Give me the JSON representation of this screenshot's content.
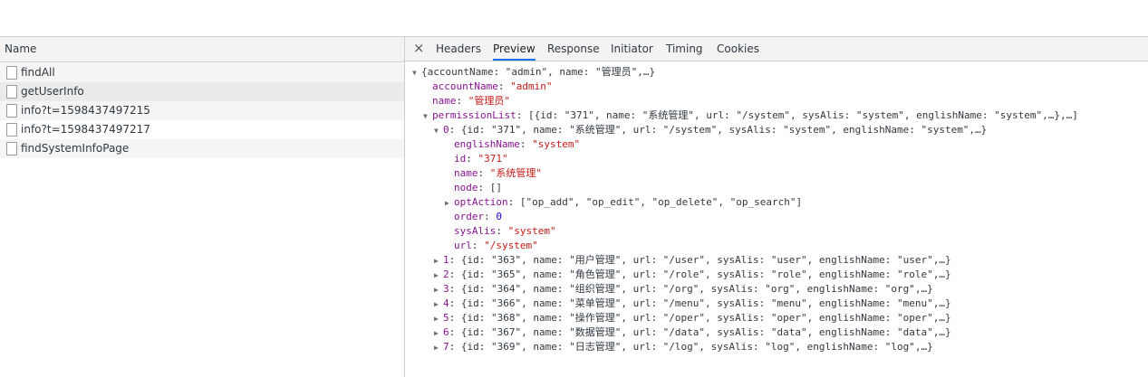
{
  "network": {
    "column_header": "Name",
    "requests": [
      {
        "name": "findAll"
      },
      {
        "name": "getUserInfo"
      },
      {
        "name": "info?t=1598437497215"
      },
      {
        "name": "info?t=1598437497217"
      },
      {
        "name": "findSystemInfoPage"
      }
    ]
  },
  "panel": {
    "close_glyph": "×",
    "tabs": [
      "Headers",
      "Preview",
      "Response",
      "Initiator",
      "Timing",
      "Cookies"
    ],
    "active_tab": "Preview"
  },
  "preview": {
    "root_summary": "{accountName: \"admin\", name: \"管理员\",…}",
    "accountName_key": "accountName",
    "accountName_value": "\"admin\"",
    "name_key": "name",
    "name_value": "\"管理员\"",
    "permissionList_key": "permissionList",
    "permissionList_summary": "[{id: \"371\", name: \"系统管理\", url: \"/system\", sysAlis: \"system\", englishName: \"system\",…},…]",
    "item0_key": "0",
    "item0_summary": "{id: \"371\", name: \"系统管理\", url: \"/system\", sysAlis: \"system\", englishName: \"system\",…}",
    "item0": {
      "englishName_key": "englishName",
      "englishName_value": "\"system\"",
      "id_key": "id",
      "id_value": "\"371\"",
      "name_key": "name",
      "name_value": "\"系统管理\"",
      "node_key": "node",
      "node_value": "[]",
      "optAction_key": "optAction",
      "optAction_value": "[\"op_add\", \"op_edit\", \"op_delete\", \"op_search\"]",
      "order_key": "order",
      "order_value": "0",
      "sysAlis_key": "sysAlis",
      "sysAlis_value": "\"system\"",
      "url_key": "url",
      "url_value": "\"/system\""
    },
    "collapsed_items": [
      {
        "index": "1",
        "summary": "{id: \"363\", name: \"用户管理\", url: \"/user\", sysAlis: \"user\", englishName: \"user\",…}"
      },
      {
        "index": "2",
        "summary": "{id: \"365\", name: \"角色管理\", url: \"/role\", sysAlis: \"role\", englishName: \"role\",…}"
      },
      {
        "index": "3",
        "summary": "{id: \"364\", name: \"组织管理\", url: \"/org\", sysAlis: \"org\", englishName: \"org\",…}"
      },
      {
        "index": "4",
        "summary": "{id: \"366\", name: \"菜单管理\", url: \"/menu\", sysAlis: \"menu\", englishName: \"menu\",…}"
      },
      {
        "index": "5",
        "summary": "{id: \"368\", name: \"操作管理\", url: \"/oper\", sysAlis: \"oper\", englishName: \"oper\",…}"
      },
      {
        "index": "6",
        "summary": "{id: \"367\", name: \"数据管理\", url: \"/data\", sysAlis: \"data\", englishName: \"data\",…}"
      },
      {
        "index": "7",
        "summary": "{id: \"369\", name: \"日志管理\", url: \"/log\", sysAlis: \"log\", englishName: \"log\",…}"
      }
    ],
    "colors": {
      "key": "#881391",
      "string": "#c41a16",
      "number": "#1c00cf"
    }
  }
}
